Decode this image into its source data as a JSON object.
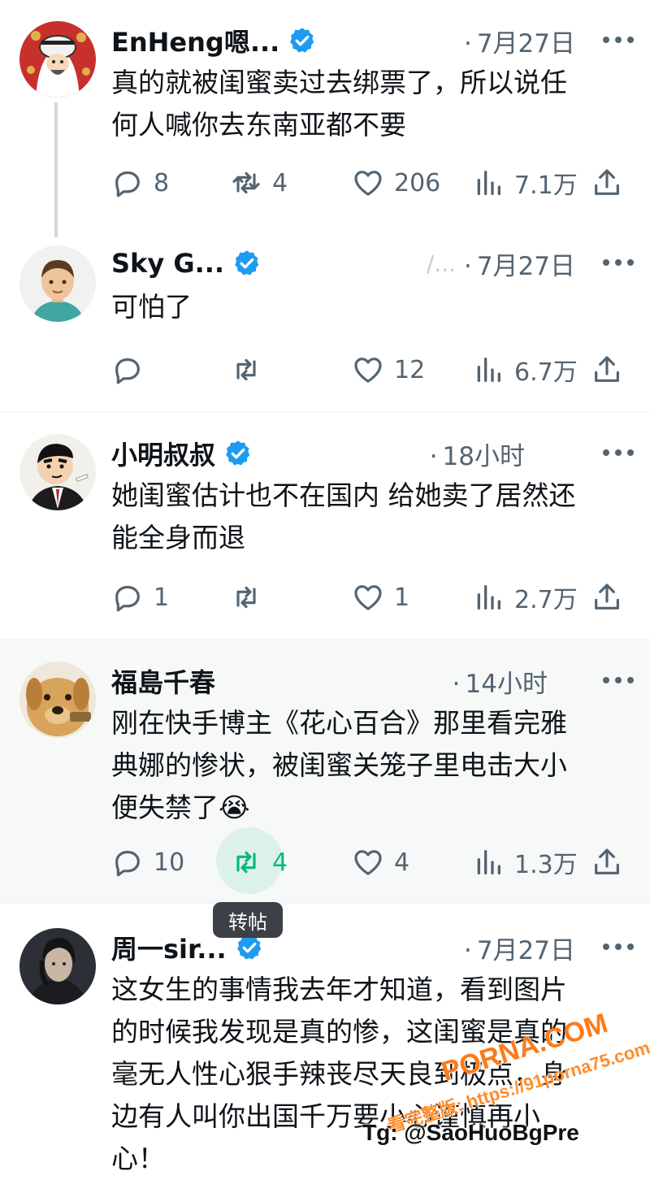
{
  "icons": {
    "verified": "verified-badge-icon",
    "reply": "comment-icon",
    "repost": "repost-icon",
    "like": "heart-icon",
    "views": "views-bar-chart-icon",
    "share": "share-upload-icon",
    "more": "more-dots-icon"
  },
  "colors": {
    "verified": "#1d9bf0",
    "text_primary": "#0f1419",
    "text_secondary": "#536471",
    "repost_active": "#00ba7c"
  },
  "posts": [
    {
      "name": "EnHeng嗯...",
      "verified": true,
      "handle": "",
      "time": "7月27日",
      "text": "真的就被闺蜜卖过去绑票了，所以说任\n何人喊你去东南亚都不要",
      "reply": "8",
      "repost": "4",
      "like": "206",
      "views": "7.1万"
    },
    {
      "name": "Sky G...",
      "verified": true,
      "handle": "/...",
      "time": "7月27日",
      "text": "可怕了",
      "reply": "",
      "repost": "",
      "like": "12",
      "views": "6.7万"
    },
    {
      "name": "小明叔叔",
      "verified": true,
      "handle": "",
      "time": "18小时",
      "text": "她闺蜜估计也不在国内 给她卖了居然还\n能全身而退",
      "reply": "1",
      "repost": "",
      "like": "1",
      "views": "2.7万"
    },
    {
      "name": "福島千春",
      "verified": false,
      "handle": "",
      "time": "14小时",
      "text": "刚在快手博主《花心百合》那里看完雅\n典娜的惨状，被闺蜜关笼子里电击大小\n便失禁了😭",
      "reply": "10",
      "repost": "4",
      "like": "4",
      "views": "1.3万",
      "tooltip": "转帖"
    },
    {
      "name": "周一sir...",
      "verified": true,
      "handle": "",
      "time": "7月27日",
      "text": "这女生的事情我去年才知道，看到图片\n的时候我发现是真的惨，这闺蜜是真的\n毫无人性心狠手辣丧尽天良到极点，身\n边有人叫你出国千万要小心谨慎再小\n心！"
    }
  ],
  "watermarks": {
    "site": "PORNA.COM",
    "url": "看完整版: https://91porna75.com",
    "tg": "Tg: @SaoHuoBgPre"
  }
}
